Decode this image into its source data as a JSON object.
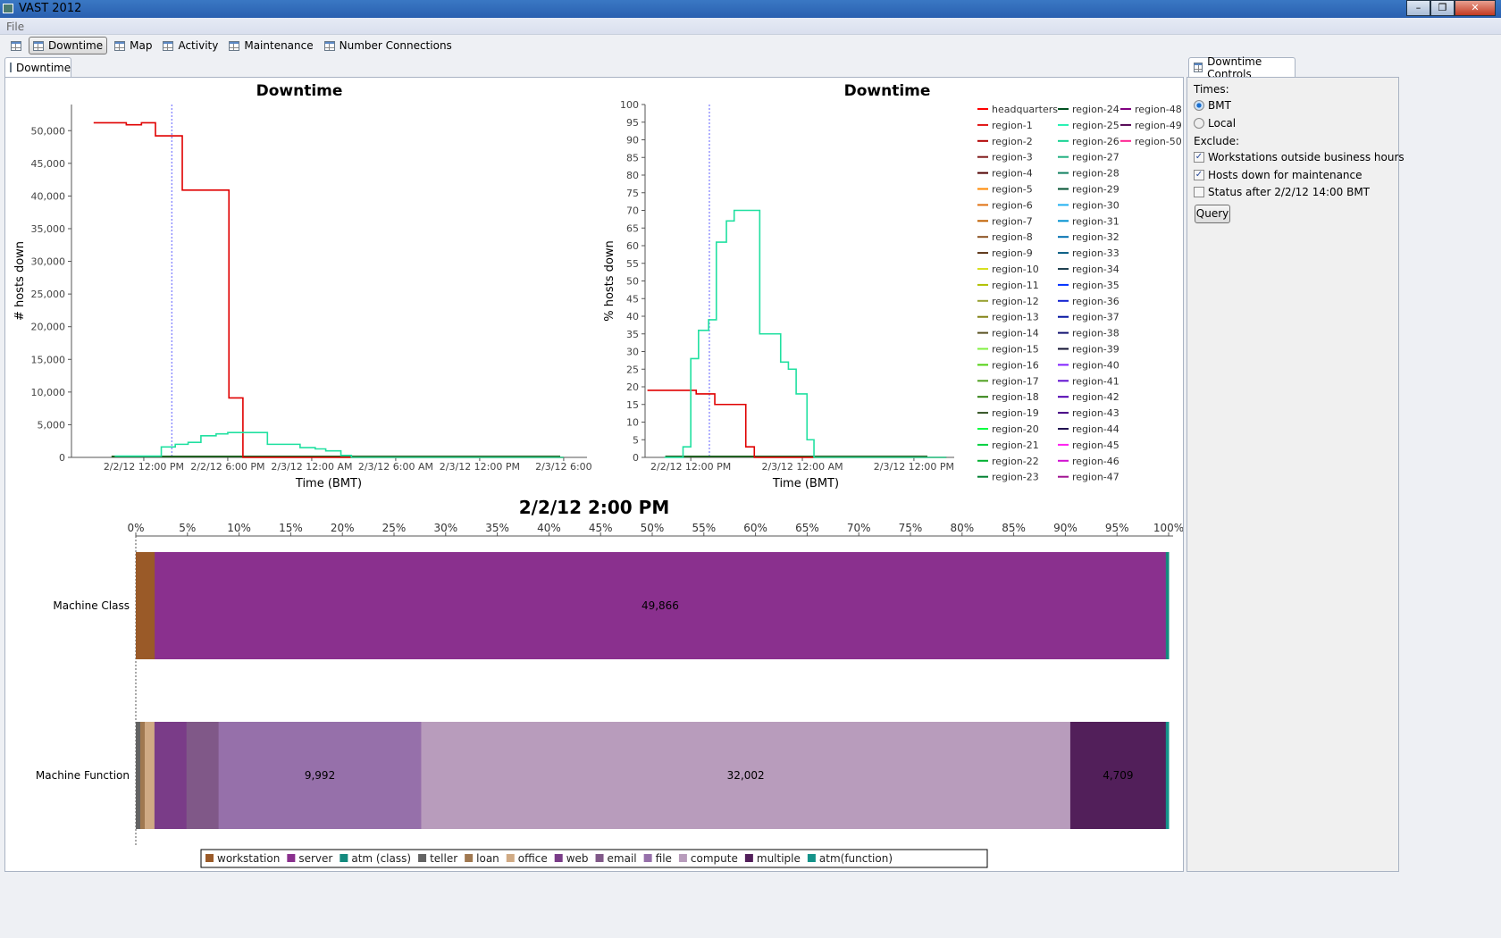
{
  "window": {
    "title": "VAST 2012"
  },
  "menu": {
    "file": "File"
  },
  "toolbar": {
    "items": [
      "Downtime",
      "Map",
      "Activity",
      "Maintenance",
      "Number Connections"
    ],
    "active": "Downtime"
  },
  "main_tab": "Downtime",
  "controls": {
    "tab": "Downtime Controls",
    "times_label": "Times:",
    "bmt": "BMT",
    "local": "Local",
    "times_selected": "BMT",
    "exclude_label": "Exclude:",
    "exclude": [
      {
        "label": "Workstations outside business hours",
        "checked": true
      },
      {
        "label": "Hosts down for maintenance",
        "checked": true
      },
      {
        "label": "Status after 2/2/12 14:00 BMT",
        "checked": false
      }
    ],
    "query": "Query"
  },
  "chart_data": [
    {
      "type": "line",
      "step": true,
      "title": "Downtime",
      "xlabel": "Time (BMT)",
      "ylabel": "# hosts down",
      "ylim": [
        0,
        54000
      ],
      "yticks": [
        0,
        5000,
        10000,
        15000,
        20000,
        25000,
        30000,
        35000,
        40000,
        45000,
        50000
      ],
      "yticklabels": [
        "0",
        "5,000",
        "10,000",
        "15,000",
        "20,000",
        "25,000",
        "30,000",
        "35,000",
        "40,000",
        "45,000",
        "50,000"
      ],
      "xlim": [
        "2012-02-02T06:50",
        "2012-02-03T19:40"
      ],
      "xticks": [
        "2012-02-02T12:00",
        "2012-02-02T18:00",
        "2012-02-03T00:00",
        "2012-02-03T06:00",
        "2012-02-03T12:00",
        "2012-02-03T18:00"
      ],
      "xticklabels": [
        "2/2/12 12:00 PM",
        "2/2/12 6:00 PM",
        "2/3/12 12:00 AM",
        "2/3/12 6:00 AM",
        "2/3/12 12:00 PM",
        "2/3/12 6:00"
      ],
      "cursor": "2012-02-02T14:00",
      "series": [
        {
          "color": "#e00000",
          "x": [
            "2012-02-02T08:25",
            "2012-02-02T10:45",
            "2012-02-02T11:50",
            "2012-02-02T12:50",
            "2012-02-02T14:45",
            "2012-02-02T18:05",
            "2012-02-02T19:05",
            "2012-02-03T18:00"
          ],
          "y": [
            51200,
            50900,
            51200,
            49200,
            40900,
            9100,
            0,
            0
          ]
        },
        {
          "color": "#20e0a0",
          "x": [
            "2012-02-02T09:55",
            "2012-02-02T13:15",
            "2012-02-02T14:15",
            "2012-02-02T15:10",
            "2012-02-02T16:05",
            "2012-02-02T17:10",
            "2012-02-02T18:00",
            "2012-02-02T20:50",
            "2012-02-02T23:10",
            "2012-02-03T00:15",
            "2012-02-03T01:00",
            "2012-02-03T02:05",
            "2012-02-03T02:50",
            "2012-02-03T18:00"
          ],
          "y": [
            200,
            1600,
            2000,
            2300,
            3300,
            3600,
            3800,
            2000,
            1500,
            1300,
            1000,
            300,
            0,
            0
          ]
        }
      ]
    },
    {
      "type": "line",
      "step": true,
      "title": "Downtime",
      "xlabel": "Time (BMT)",
      "ylabel": "% hosts down",
      "ylim": [
        0,
        100
      ],
      "yticks": [
        0,
        5,
        10,
        15,
        20,
        25,
        30,
        35,
        40,
        45,
        50,
        55,
        60,
        65,
        70,
        75,
        80,
        85,
        90,
        95,
        100
      ],
      "xlim": [
        "2012-02-02T07:05",
        "2012-02-03T16:20"
      ],
      "xticks": [
        "2012-02-02T12:00",
        "2012-02-03T00:00",
        "2012-02-03T12:00"
      ],
      "xticklabels": [
        "2/2/12 12:00 PM",
        "2/3/12 12:00 AM",
        "2/3/12 12:00 PM"
      ],
      "cursor": "2012-02-02T14:00",
      "series": [
        {
          "name": "headquarters",
          "color": "#e00000",
          "x": [
            "2012-02-02T07:20",
            "2012-02-02T12:35",
            "2012-02-02T14:35",
            "2012-02-02T17:55",
            "2012-02-02T18:50",
            "2012-02-03T15:30"
          ],
          "y": [
            19,
            18,
            15,
            3,
            0,
            0
          ]
        },
        {
          "name": "region-25",
          "color": "#20e0a0",
          "x": [
            "2012-02-02T09:10",
            "2012-02-02T11:10",
            "2012-02-02T12:00",
            "2012-02-02T12:50",
            "2012-02-02T13:55",
            "2012-02-02T14:45",
            "2012-02-02T15:50",
            "2012-02-02T16:40",
            "2012-02-02T19:25",
            "2012-02-02T21:40",
            "2012-02-02T22:30",
            "2012-02-02T23:20",
            "2012-02-03T00:30",
            "2012-02-03T01:15",
            "2012-02-03T15:30"
          ],
          "y": [
            0,
            3,
            28,
            36,
            39,
            61,
            67,
            70,
            35,
            27,
            25,
            18,
            5,
            0,
            0
          ]
        }
      ],
      "legend": {
        "position": "right",
        "entries": [
          {
            "name": "headquarters",
            "color": "#ff0000"
          },
          {
            "name": "region-1",
            "color": "#e01010"
          },
          {
            "name": "region-2",
            "color": "#b00000"
          },
          {
            "name": "region-3",
            "color": "#801818"
          },
          {
            "name": "region-4",
            "color": "#500000"
          },
          {
            "name": "region-5",
            "color": "#ff8800"
          },
          {
            "name": "region-6",
            "color": "#e07010"
          },
          {
            "name": "region-7",
            "color": "#c06000"
          },
          {
            "name": "region-8",
            "color": "#8a5020"
          },
          {
            "name": "region-9",
            "color": "#583010"
          },
          {
            "name": "region-10",
            "color": "#d8e020"
          },
          {
            "name": "region-11",
            "color": "#b0c000"
          },
          {
            "name": "region-12",
            "color": "#98a030"
          },
          {
            "name": "region-13",
            "color": "#808010"
          },
          {
            "name": "region-14",
            "color": "#585020"
          },
          {
            "name": "region-15",
            "color": "#80f040"
          },
          {
            "name": "region-16",
            "color": "#50d010"
          },
          {
            "name": "region-17",
            "color": "#50a020"
          },
          {
            "name": "region-18",
            "color": "#308010"
          },
          {
            "name": "region-19",
            "color": "#305020"
          },
          {
            "name": "region-20",
            "color": "#00ff40"
          },
          {
            "name": "region-21",
            "color": "#00d040"
          },
          {
            "name": "region-22",
            "color": "#00b030"
          },
          {
            "name": "region-23",
            "color": "#008030"
          },
          {
            "name": "region-24",
            "color": "#005020"
          },
          {
            "name": "region-25",
            "color": "#20f0b0"
          },
          {
            "name": "region-26",
            "color": "#10d090"
          },
          {
            "name": "region-27",
            "color": "#20b080"
          },
          {
            "name": "region-28",
            "color": "#108060"
          },
          {
            "name": "region-29",
            "color": "#005030"
          },
          {
            "name": "region-30",
            "color": "#20b0f0"
          },
          {
            "name": "region-31",
            "color": "#0090d0"
          },
          {
            "name": "region-32",
            "color": "#0070b0"
          },
          {
            "name": "region-33",
            "color": "#005880"
          },
          {
            "name": "region-34",
            "color": "#204050"
          },
          {
            "name": "region-35",
            "color": "#0030ff"
          },
          {
            "name": "region-36",
            "color": "#1020d0"
          },
          {
            "name": "region-37",
            "color": "#0010a0"
          },
          {
            "name": "region-38",
            "color": "#101070"
          },
          {
            "name": "region-39",
            "color": "#101030"
          },
          {
            "name": "region-40",
            "color": "#8020ff"
          },
          {
            "name": "region-41",
            "color": "#6010d0"
          },
          {
            "name": "region-42",
            "color": "#5000b0"
          },
          {
            "name": "region-43",
            "color": "#400080"
          },
          {
            "name": "region-44",
            "color": "#201050"
          },
          {
            "name": "region-45",
            "color": "#ff20f0"
          },
          {
            "name": "region-46",
            "color": "#d010d0"
          },
          {
            "name": "region-47",
            "color": "#a01090"
          },
          {
            "name": "region-48",
            "color": "#800080"
          },
          {
            "name": "region-49",
            "color": "#500050"
          },
          {
            "name": "region-50",
            "color": "#ff2090"
          }
        ]
      }
    },
    {
      "type": "bar",
      "orientation": "horizontal",
      "stacked": "percent",
      "title": "2/2/12 2:00 PM",
      "xlim": [
        0,
        100
      ],
      "xticklabels": [
        "0%",
        "5%",
        "10%",
        "15%",
        "20%",
        "25%",
        "30%",
        "35%",
        "40%",
        "45%",
        "50%",
        "55%",
        "60%",
        "65%",
        "70%",
        "75%",
        "80%",
        "85%",
        "90%",
        "95%",
        "100%"
      ],
      "categories": [
        "Machine Class",
        "Machine Function"
      ],
      "series": [
        {
          "name": "workstation",
          "color": "#9a5a28",
          "values": [
            930,
            0
          ]
        },
        {
          "name": "server",
          "color": "#8a308e",
          "values": [
            49866,
            0
          ]
        },
        {
          "name": "atm (class)",
          "color": "#138a7e",
          "values": [
            140,
            0
          ]
        },
        {
          "name": "teller",
          "color": "#636363",
          "values": [
            0,
            220
          ]
        },
        {
          "name": "loan",
          "color": "#a07850",
          "values": [
            0,
            220
          ]
        },
        {
          "name": "office",
          "color": "#d0aa84",
          "values": [
            0,
            480
          ]
        },
        {
          "name": "web",
          "color": "#7a3c88",
          "values": [
            0,
            1580
          ]
        },
        {
          "name": "email",
          "color": "#805888",
          "values": [
            0,
            1580
          ]
        },
        {
          "name": "file",
          "color": "#9670aa",
          "values": [
            0,
            9992
          ]
        },
        {
          "name": "compute",
          "color": "#b89cbc",
          "values": [
            0,
            32002
          ]
        },
        {
          "name": "multiple",
          "color": "#521f5a",
          "values": [
            0,
            4709
          ]
        },
        {
          "name": "atm(function)",
          "color": "#14938a",
          "values": [
            0,
            140
          ]
        }
      ],
      "data_labels": [
        "49,866",
        "9,992",
        "32,002",
        "4,709"
      ],
      "legend": {
        "position": "bottom"
      }
    }
  ]
}
